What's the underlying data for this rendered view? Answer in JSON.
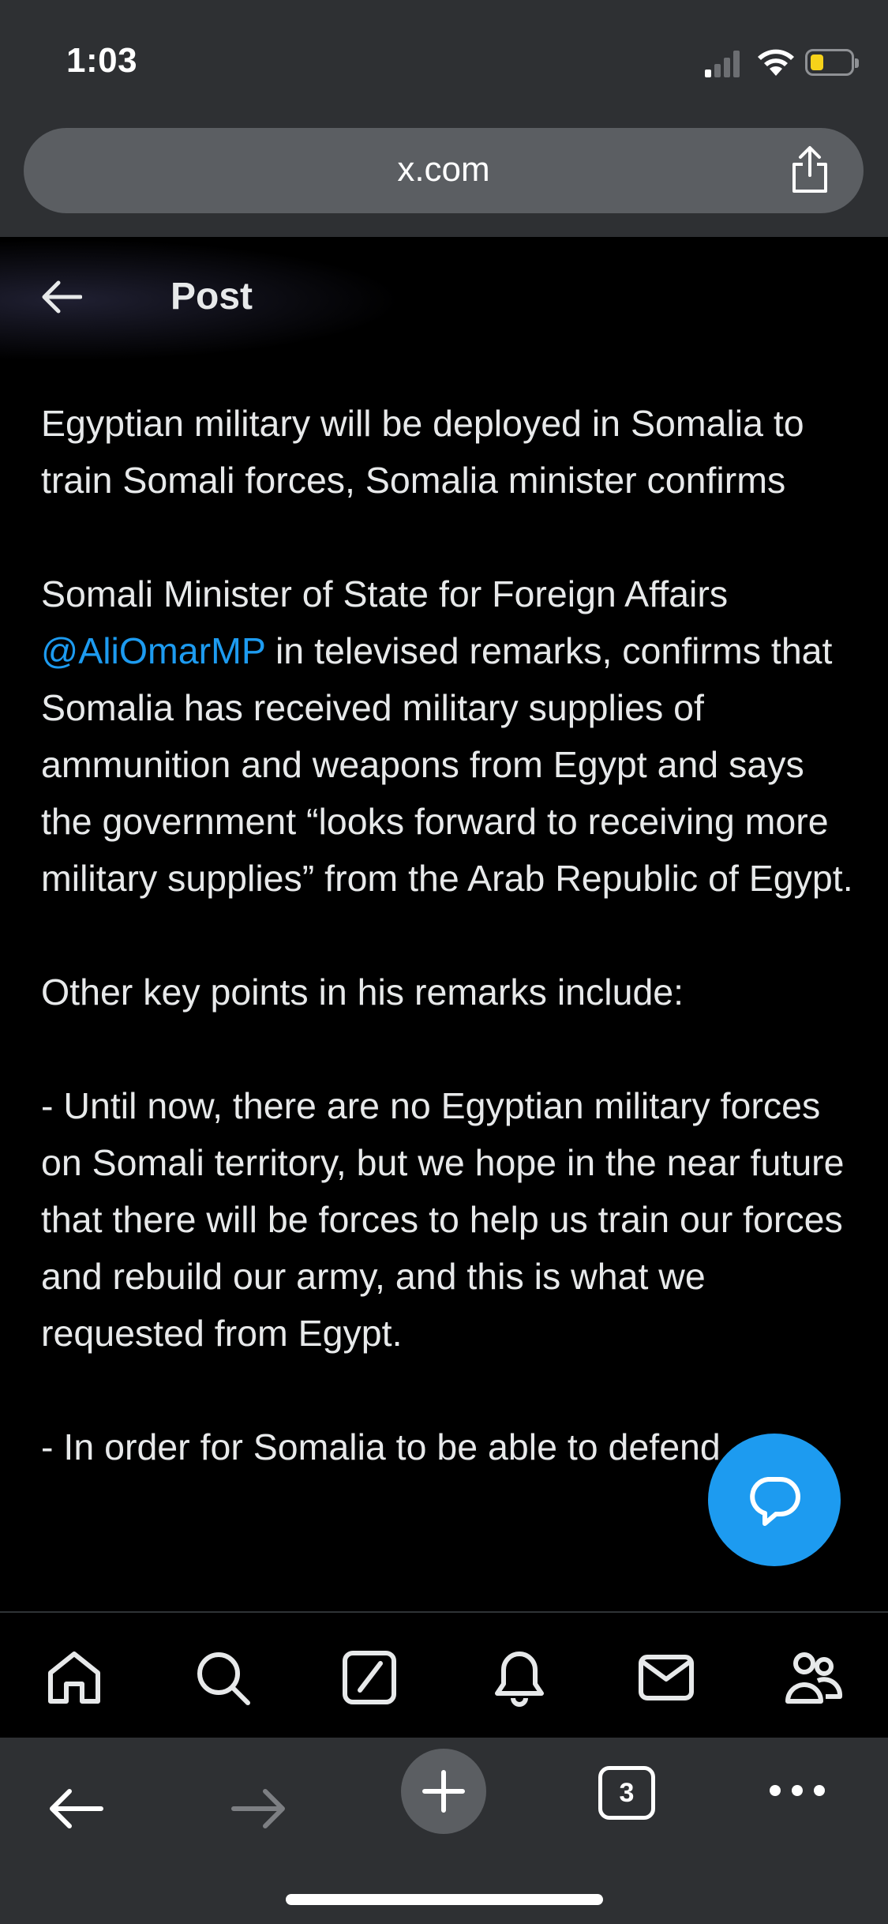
{
  "status_bar": {
    "time": "1:03"
  },
  "browser": {
    "url": "x.com",
    "open_tabs": "3"
  },
  "header": {
    "title": "Post"
  },
  "post": {
    "p1": "Egyptian military will be deployed in Somalia to train Somali forces, Somalia minister confirms",
    "p2_before": "Somali Minister of State for Foreign Affairs ",
    "mention": "@AliOmarMP",
    "p2_after": " in televised remarks, confirms that Somalia has received military supplies of ammunition and weapons from Egypt and says the government “looks forward to receiving more military supplies” from the Arab Republic of Egypt.",
    "p3": "Other key points in his remarks include:",
    "p4": "- Until now, there are no Egyptian military forces on Somali territory, but we hope in the near future that there will be forces to help us train our forces and rebuild our army, and this is what we requested from Egypt.",
    "p5": "- In order for Somalia to be able to defend"
  },
  "colors": {
    "accent": "#1d9bf0",
    "chrome": "#2e3033",
    "battery": "#f6d21a"
  },
  "tabbar": {
    "icons": [
      "home-icon",
      "search-icon",
      "compose-icon",
      "notifications-icon",
      "messages-icon",
      "communities-icon"
    ]
  }
}
